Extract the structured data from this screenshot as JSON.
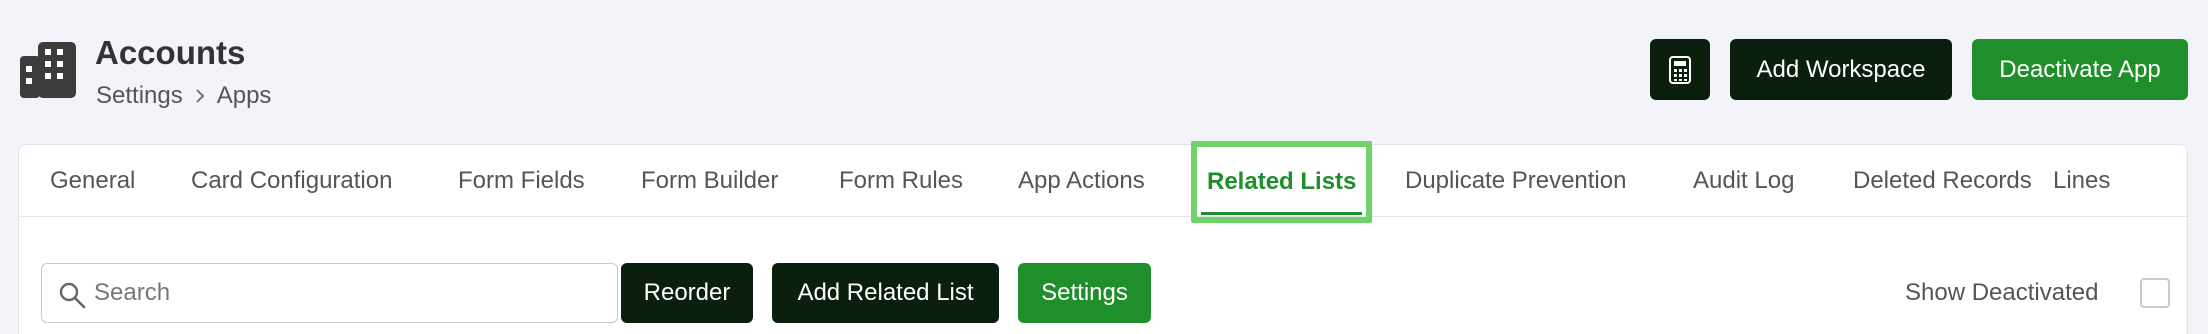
{
  "header": {
    "title": "Accounts",
    "breadcrumb": [
      "Settings",
      "Apps"
    ],
    "app_icon": "building-icon",
    "buttons": {
      "calculator_icon": "calculator-icon",
      "add_workspace": "Add Workspace",
      "deactivate_app": "Deactivate App"
    }
  },
  "tabs": [
    {
      "label": "General"
    },
    {
      "label": "Card Configuration"
    },
    {
      "label": "Form Fields"
    },
    {
      "label": "Form Builder"
    },
    {
      "label": "Form Rules"
    },
    {
      "label": "App Actions"
    },
    {
      "label": "Related Lists",
      "active": true
    },
    {
      "label": "Duplicate Prevention"
    },
    {
      "label": "Audit Log"
    },
    {
      "label": "Deleted Records"
    },
    {
      "label": "Lines"
    }
  ],
  "toolbar": {
    "search_placeholder": "Search",
    "reorder": "Reorder",
    "add_related_list": "Add Related List",
    "settings": "Settings",
    "show_deactivated": "Show Deactivated",
    "show_deactivated_checked": false
  },
  "colors": {
    "accent_green": "#1f8f2b",
    "dark_button": "#0b1f0f",
    "active_tab_outline": "#6fd36a",
    "background": "#f3f4f9"
  }
}
